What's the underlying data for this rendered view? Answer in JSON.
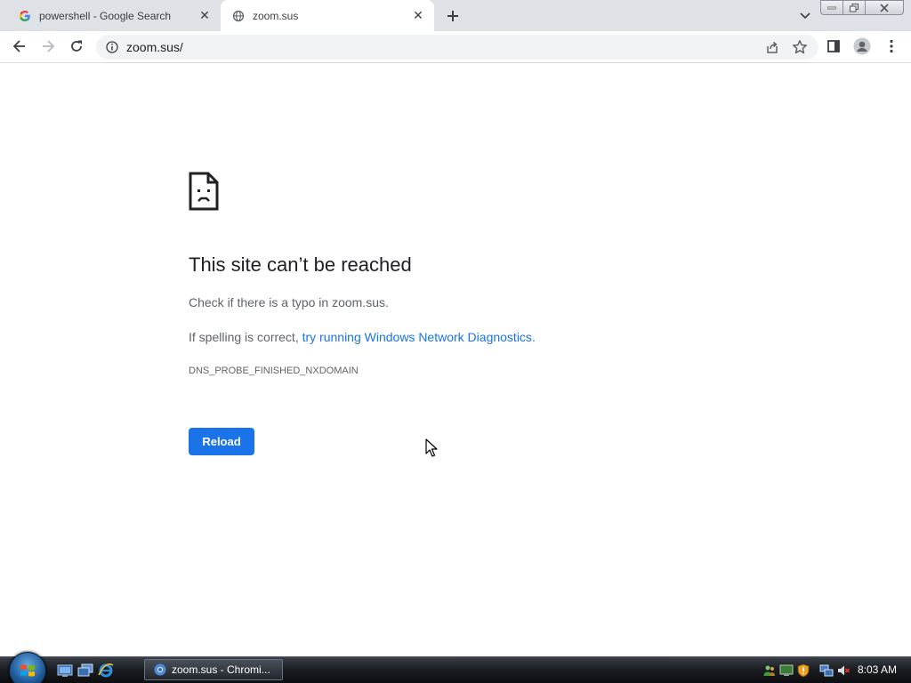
{
  "tabs": [
    {
      "title": "powershell - Google Search",
      "favicon": "google-g-icon",
      "active": false
    },
    {
      "title": "zoom.sus",
      "favicon": "globe-icon",
      "active": true
    }
  ],
  "toolbar": {
    "url": "zoom.sus/"
  },
  "error_page": {
    "title": "This site can’t be reached",
    "line1": "Check if there is a typo in zoom.sus.",
    "line2_prefix": "If spelling is correct, ",
    "line2_link": "try running Windows Network Diagnostics",
    "line2_suffix": ".",
    "error_code": "DNS_PROBE_FINISHED_NXDOMAIN",
    "reload_label": "Reload"
  },
  "taskbar": {
    "task_label": "zoom.sus - Chromi...",
    "clock": "8:03 AM"
  },
  "colors": {
    "accent": "#1a73e8",
    "tabstrip": "#dee1e6",
    "omnibox": "#f1f3f4"
  }
}
